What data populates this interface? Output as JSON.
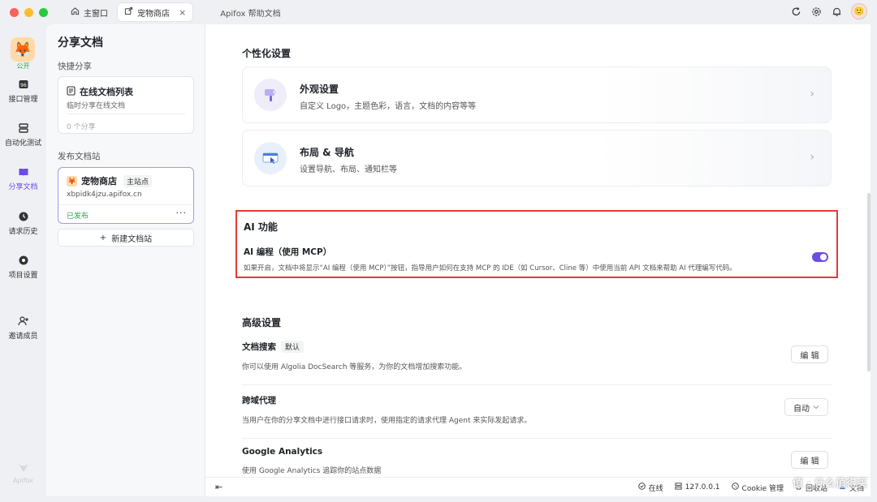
{
  "titlebar": {
    "tabs": [
      {
        "label": "主窗口",
        "icon": "home-icon"
      },
      {
        "label": "宠物商店",
        "icon": "share-icon",
        "close": "×"
      },
      {
        "label": "Apifox 帮助文档"
      }
    ]
  },
  "rail": {
    "project_badge": "公开",
    "items": [
      {
        "label": "接口管理"
      },
      {
        "label": "自动化测试"
      },
      {
        "label": "分享文档"
      },
      {
        "label": "请求历史"
      },
      {
        "label": "项目设置"
      },
      {
        "label": "邀请成员"
      }
    ],
    "brand": "Apifox"
  },
  "panel": {
    "title": "分享文档",
    "quick_share_label": "快捷分享",
    "quick_card": {
      "title": "在线文档列表",
      "subtitle": "临时分享在线文档",
      "count": "0 个分享"
    },
    "publish_label": "发布文档站",
    "site_card": {
      "name": "宠物商店",
      "badge": "主站点",
      "url": "xbpidk4jzu.apifox.cn",
      "status": "已发布",
      "more": "···"
    },
    "new_site": "新建文档站",
    "new_site_plus": "+"
  },
  "main": {
    "personalize_title": "个性化设置",
    "appearance": {
      "title": "外观设置",
      "subtitle": "自定义 Logo，主题色彩，语言，文档的内容等等",
      "chevron": "›"
    },
    "layout": {
      "title": "布局 & 导航",
      "subtitle": "设置导航、布局、通知栏等",
      "chevron": "›"
    },
    "ai": {
      "title": "AI 功能",
      "item_title": "AI 编程（使用 MCP）",
      "item_desc": "如果开启，文档中将显示“AI 编程（使用 MCP）”按钮，指导用户如何在支持 MCP 的 IDE（如 Cursor、Cline 等）中使用当前 API 文档来帮助 AI 代理编写代码。",
      "enabled": true
    },
    "advanced_title": "高级设置",
    "doc_search": {
      "title": "文档搜索",
      "badge": "默认",
      "desc": "你可以使用 Algolia DocSearch 等服务，为你的文档增加搜索功能。",
      "button": "编 辑"
    },
    "cors_proxy": {
      "title": "跨域代理",
      "desc": "当用户在你的分享文档中进行接口请求时，使用指定的请求代理 Agent 来实际发起请求。",
      "select": "自动"
    },
    "ga": {
      "title": "Google Analytics",
      "desc": "使用 Google Analytics 追踪你的站点数据",
      "button": "编 辑"
    }
  },
  "statusbar": {
    "collapse": "⇤",
    "online": "在线",
    "host": "127.0.0.1",
    "cookie": "Cookie 管理",
    "recycle": "回收站",
    "doc": "文档"
  },
  "watermark": "值 · 什么值得买",
  "colors": {
    "accent": "#6b4de6",
    "highlight_border": "#e33a3a",
    "published": "#28a745"
  }
}
